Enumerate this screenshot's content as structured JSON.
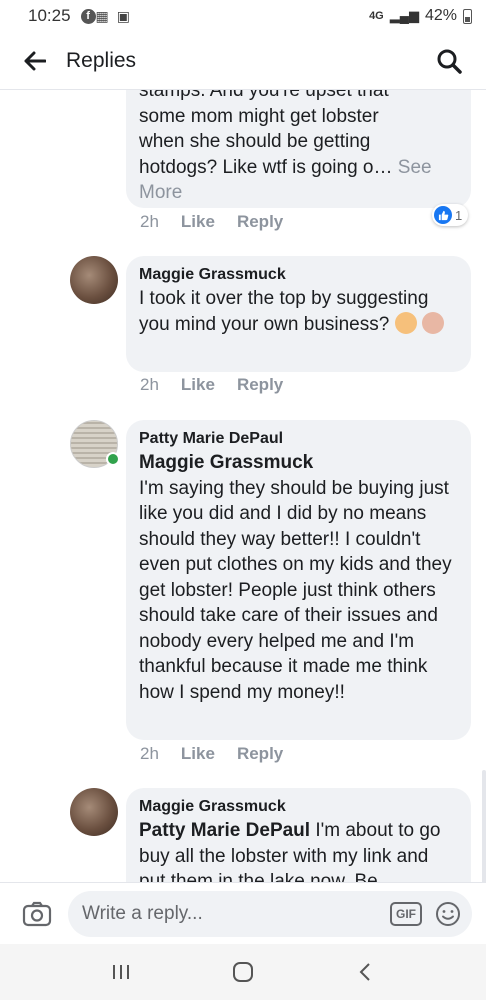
{
  "status_bar": {
    "time": "10:25",
    "network": "4G",
    "battery": "42%"
  },
  "header": {
    "title": "Replies"
  },
  "comments": [
    {
      "name": "",
      "text_lines": [
        "stamps. And you're upset that",
        "some mom might get lobster",
        "when she should be getting"
      ],
      "text_last": "hotdogs? Like wtf is going o… ",
      "see_more": "See More",
      "time": "2h",
      "like": "Like",
      "reply": "Reply",
      "reaction_count": "1"
    },
    {
      "name": "Maggie Grassmuck",
      "text": "I took it over the top by suggesting you mind your own business?",
      "time": "2h",
      "like": "Like",
      "reply": "Reply"
    },
    {
      "name": "Patty Marie DePaul",
      "mention": "Maggie Grassmuck",
      "text": "I'm saying they should be buying just like you did and I did by no means should they way better!! I couldn't even put clothes on my kids and they get lobster! People just think others should take care of their issues and nobody every helped me and I'm thankful because it made me think how I spend my money!!",
      "time": "2h",
      "like": "Like",
      "reply": "Reply",
      "online": true
    },
    {
      "name": "Maggie Grassmuck",
      "mention": "Patty Marie DePaul",
      "text": " I'm about to go buy all the lobster with my link and put them in the lake now. Be"
    }
  ],
  "composer": {
    "placeholder": "Write a reply...",
    "gif_label": "GIF"
  },
  "colors": {
    "bubble": "#f0f2f5",
    "muted": "#8d949e",
    "like_blue": "#1877f2",
    "online_green": "#31a24c"
  }
}
